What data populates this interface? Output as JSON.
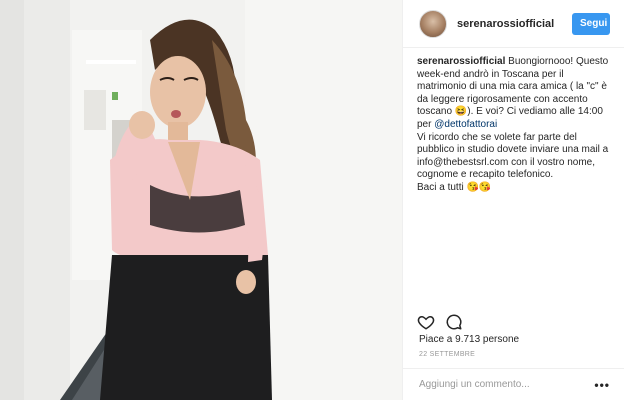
{
  "post": {
    "username": "serenarossiofficial",
    "follow_label": "Segui",
    "caption": {
      "username": "serenarossiofficial",
      "line1": "Buongiornooo! Questo week-end andrò in Toscana per il matrimonio di una mia cara amica ( la \"c\" è da leggere rigorosamente con accento toscano 😆). E voi? Ci vediamo alle 14:00 per ",
      "mention": "@dettofattorai",
      "line2": "Vi ricordo che se volete far parte del pubblico in studio dovete inviare una mail a info@thebestsrl.com con il vostro nome, cognome e recapito telefonico.",
      "line3": "Baci a tutti 😘😘"
    },
    "likes_text": "Piace a 9.713 persone",
    "date_text": "22 SETTEMBRE",
    "comment_placeholder": "Aggiungi un commento...",
    "more_label": "•••",
    "icons": [
      "heart-icon",
      "comment-icon",
      "more-options-icon"
    ]
  },
  "colors": {
    "follow_button": "#3897f0",
    "mention": "#003569",
    "muted": "#999999",
    "text": "#262626"
  }
}
